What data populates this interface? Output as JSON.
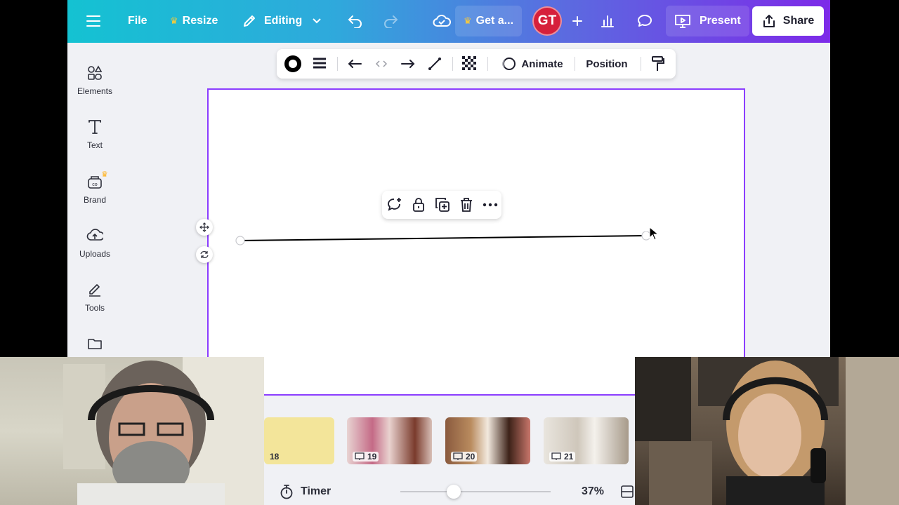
{
  "topbar": {
    "file_label": "File",
    "resize_label": "Resize",
    "editing_label": "Editing",
    "get_label": "Get a...",
    "avatar_initials": "GT",
    "present_label": "Present",
    "share_label": "Share"
  },
  "sidebar": {
    "items": [
      {
        "label": "Elements"
      },
      {
        "label": "Text"
      },
      {
        "label": "Brand"
      },
      {
        "label": "Uploads"
      },
      {
        "label": "Tools"
      }
    ]
  },
  "context_toolbar": {
    "animate_label": "Animate",
    "position_label": "Position"
  },
  "pages": [
    {
      "number": "18"
    },
    {
      "number": "19"
    },
    {
      "number": "20"
    },
    {
      "number": "21"
    }
  ],
  "footer": {
    "timer_label": "Timer",
    "zoom_value": "37%",
    "zoom_fraction": 0.34
  },
  "colors": {
    "accent": "#8b3dff",
    "avatar_bg": "#d6203b",
    "crown": "#ffcc33"
  }
}
